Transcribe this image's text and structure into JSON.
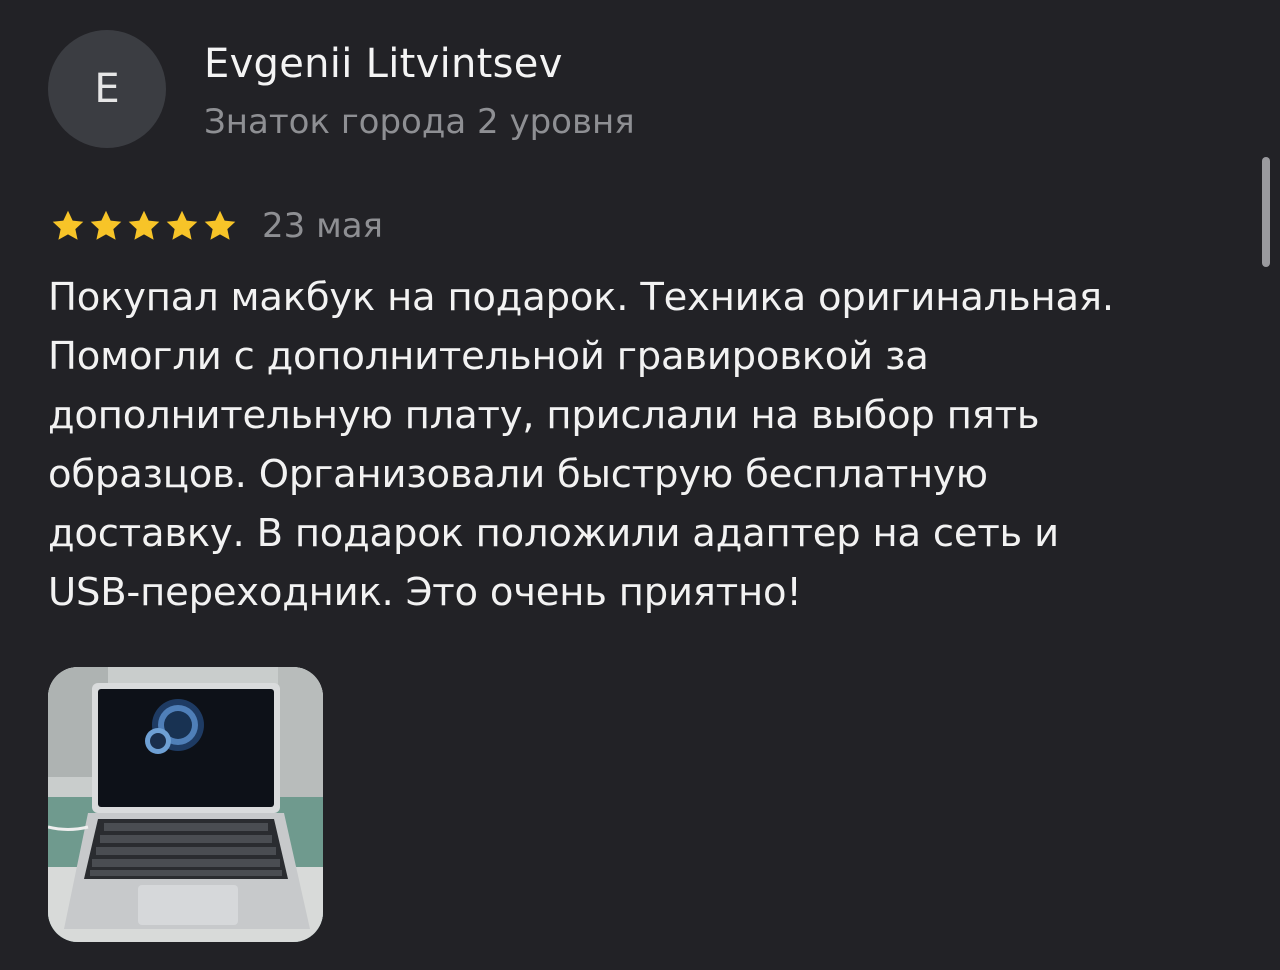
{
  "review": {
    "avatar_letter": "E",
    "author_name": "Evgenii Litvintsev",
    "author_level": "Знаток города 2 уровня",
    "rating": 5,
    "rating_max": 5,
    "date": "23 мая",
    "text": "Покупал макбук на подарок. Техника оригинальная.\nПомогли с дополнительной гравировкой за\nдополнительную плату, прислали на выбор пять\nобразцов. Организовали быструю бесплатную\nдоставку. В подарок положили адаптер на сеть и\nUSB-переходник. Это очень приятно!",
    "photos": [
      {
        "icon": "laptop-photo-thumbnail"
      }
    ]
  },
  "colors": {
    "background": "#222226",
    "star": "#f7c428",
    "secondary_text": "#8e8f93",
    "avatar_bg": "#3b3d42"
  }
}
